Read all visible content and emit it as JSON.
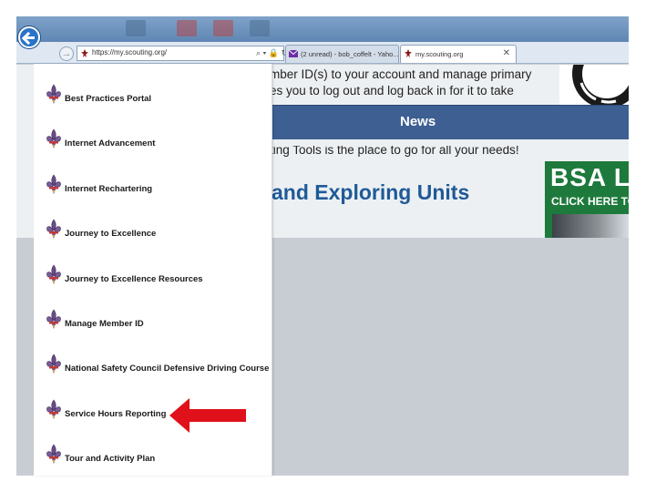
{
  "browser": {
    "url": "https://my.scouting.org/",
    "address_tools": "⌕ ▾ 🔒 ↻",
    "tabs": [
      {
        "title": "(2 unread) - bob_coffelt - Yaho..."
      },
      {
        "title": "my.scouting.org",
        "active": true,
        "close": "✕"
      }
    ],
    "back_glyph": "",
    "forward_glyph": "→"
  },
  "page": {
    "member_text_line1": "mber ID(s) to your account and manage primary",
    "member_text_line2": "es you to log out and log back in for it to take",
    "news_label": "News",
    "tools_text": "ting Tools is the place to go for all your needs!",
    "units_heading": "and Exploring Units",
    "ad": {
      "title": "BSA L",
      "subtitle": "CLICK HERE TO AC"
    }
  },
  "menu": {
    "items": [
      {
        "label": "Best Practices Portal"
      },
      {
        "label": "Internet Advancement"
      },
      {
        "label": "Internet Rechartering"
      },
      {
        "label": "Journey to Excellence"
      },
      {
        "label": "Journey to Excellence Resources"
      },
      {
        "label": "Manage Member ID"
      },
      {
        "label": "National Safety Council Defensive Driving Course"
      },
      {
        "label": "Service Hours Reporting",
        "highlighted": true
      },
      {
        "label": "Tour and Activity Plan"
      }
    ]
  },
  "colors": {
    "accent_blue": "#2a73c9",
    "news_bar": "#3d5f92",
    "heading_blue": "#1f5a99",
    "arrow_red": "#e0111a",
    "ad_green": "#1e7a3c"
  },
  "icons": {
    "menu_item_icon": "fleur-de-lis-icon",
    "back": "back-arrow-icon",
    "forward": "forward-arrow-icon"
  }
}
